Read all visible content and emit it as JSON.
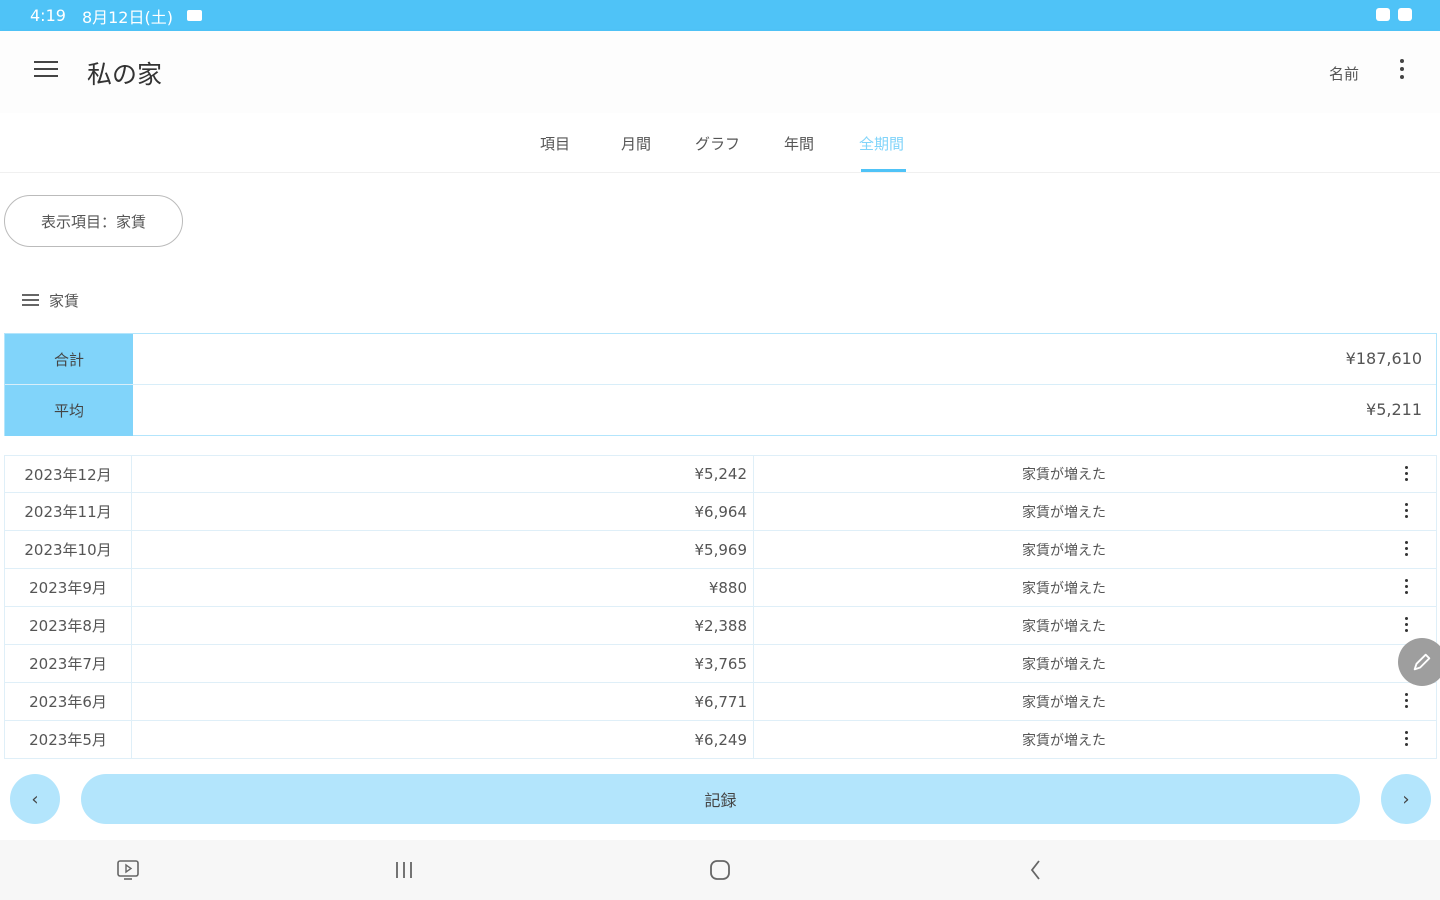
{
  "status_bar": {
    "time": "4:19",
    "date": "8月12日(土)"
  },
  "app_bar": {
    "title": "私の家",
    "name_label": "名前"
  },
  "tabs": [
    {
      "label": "項目"
    },
    {
      "label": "月間"
    },
    {
      "label": "グラフ"
    },
    {
      "label": "年間"
    },
    {
      "label": "全期間"
    }
  ],
  "active_tab": 4,
  "filter_chip": {
    "label": "表示項目：家賃"
  },
  "section": {
    "label": "家賃"
  },
  "summary": [
    {
      "label": "合計",
      "value": "¥187,610"
    },
    {
      "label": "平均",
      "value": "¥5,211"
    }
  ],
  "records": [
    {
      "date": "2023年12月",
      "amount": "¥5,242",
      "note": "家賃が増えた"
    },
    {
      "date": "2023年11月",
      "amount": "¥6,964",
      "note": "家賃が増えた"
    },
    {
      "date": "2023年10月",
      "amount": "¥5,969",
      "note": "家賃が増えた"
    },
    {
      "date": "2023年9月",
      "amount": "¥880",
      "note": "家賃が増えた"
    },
    {
      "date": "2023年8月",
      "amount": "¥2,388",
      "note": "家賃が増えた"
    },
    {
      "date": "2023年7月",
      "amount": "¥3,765",
      "note": "家賃が増えた"
    },
    {
      "date": "2023年6月",
      "amount": "¥6,771",
      "note": "家賃が増えた"
    },
    {
      "date": "2023年5月",
      "amount": "¥6,249",
      "note": "家賃が増えた"
    }
  ],
  "bottom_bar": {
    "prev_label": "‹",
    "record_label": "記録",
    "next_label": "›"
  },
  "colors": {
    "accent": "#4fc3f7",
    "accent_light": "#b3e5fc",
    "label_bg": "#81d4fa"
  }
}
